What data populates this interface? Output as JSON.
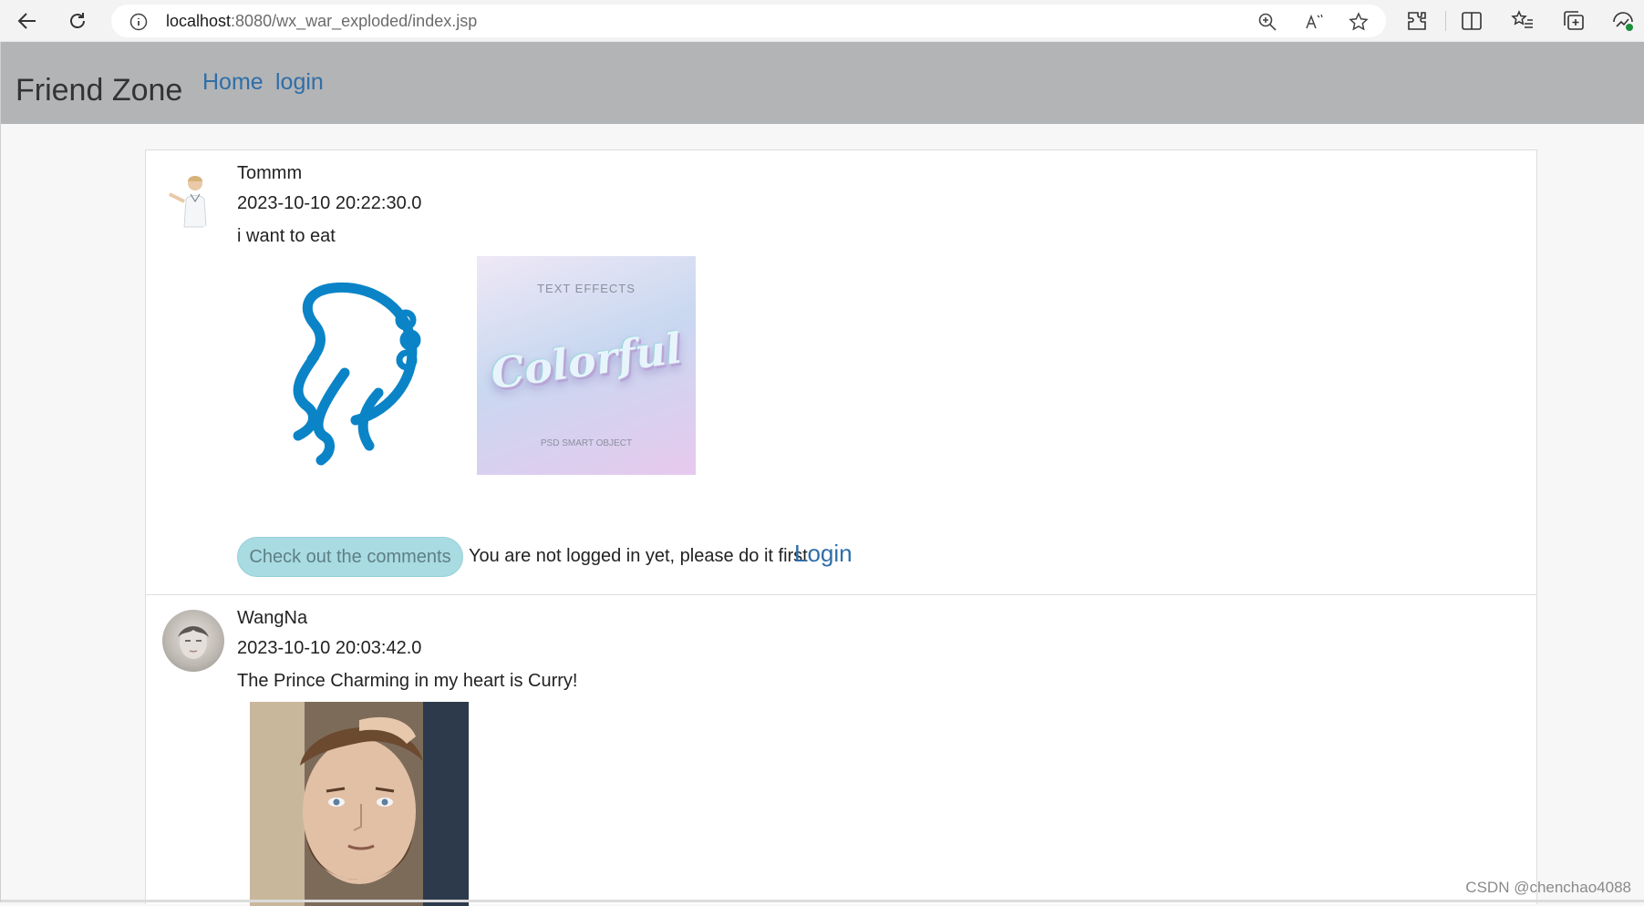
{
  "browser": {
    "url_host": "localhost",
    "url_rest": ":8080/wx_war_exploded/index.jsp"
  },
  "site": {
    "brand": "Friend Zone",
    "nav": {
      "home": "Home",
      "login": "login"
    }
  },
  "posts": [
    {
      "user": "Tommm",
      "time": "2023-10-10 20:22:30.0",
      "text": "i want to eat",
      "images": {
        "image2_top": "TEXT EFFECTS",
        "image2_main": "Colorful",
        "image2_bottom": "PSD SMART OBJECT"
      },
      "comments_button": "Check out the comments",
      "notice": "You are not logged in yet, please do it first",
      "login_link": "Login"
    },
    {
      "user": "WangNa",
      "time": "2023-10-10 20:03:42.0",
      "text": "The Prince Charming in my heart is Curry!"
    }
  ],
  "watermark": "CSDN @chenchao4088"
}
